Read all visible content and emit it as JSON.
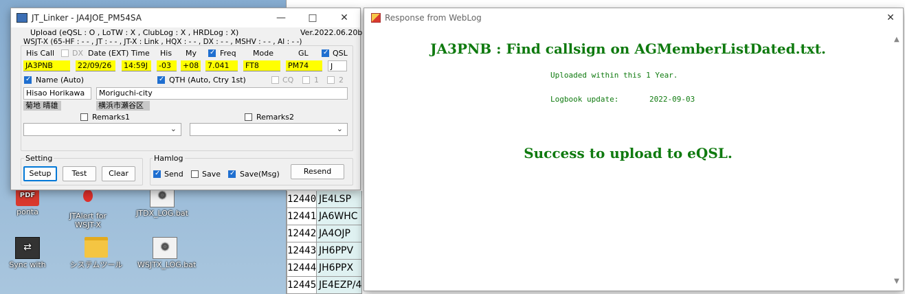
{
  "desktop": {
    "icons": [
      {
        "label": "ponta",
        "icon": "pdf-shortcut-icon"
      },
      {
        "label": "JTAlert for WSJT-X",
        "icon": "app-shortcut-icon"
      },
      {
        "label": "JTDX_LOG.bat",
        "icon": "batch-file-icon"
      },
      {
        "label": "Sync with",
        "icon": "sync-app-icon"
      },
      {
        "label": "システムツール",
        "icon": "folder-icon"
      },
      {
        "label": "WSJTX_LOG.bat",
        "icon": "batch-file-icon"
      }
    ]
  },
  "sheet": {
    "rows": [
      {
        "num": "12440",
        "call": "JE4LSP"
      },
      {
        "num": "12441",
        "call": "JA6WHC"
      },
      {
        "num": "12442",
        "call": "JA4OJP"
      },
      {
        "num": "12443",
        "call": "JH6PPV"
      },
      {
        "num": "12444",
        "call": "JH6PPX"
      },
      {
        "num": "12445",
        "call": "JE4EZP/4"
      }
    ]
  },
  "jt": {
    "title": "JT_Linker - JA4JOE_PM54SA",
    "upload_status": "Upload (eQSL : O , LoTW : X , ClubLog : X , HRDLog : X)",
    "version": "Ver.2022.06.20b",
    "wsjt_status": "WSJT-X (65-HF : - - , JT : - - , JT-X : Link , HQX : - - , DX : - - , MSHV : - - , AI : - -)",
    "headers": {
      "his_call": "His Call",
      "dx": "DX",
      "date_time": "Date (EXT) Time",
      "his": "His",
      "my": "My",
      "freq": "Freq",
      "mode": "Mode",
      "gl": "GL",
      "qsl": "QSL"
    },
    "values": {
      "his_call": "JA3PNB",
      "date": "22/09/26",
      "time": "14:59J",
      "his": "-03",
      "my": "+08",
      "freq": "7.041",
      "mode": "FT8",
      "gl": "PM74",
      "qsl": "J"
    },
    "name_label": "Name  (Auto)",
    "qth_label": "QTH  (Auto, Ctry 1st)",
    "cq_label": "CQ",
    "one_label": "1",
    "two_label": "2",
    "name_value": "Hisao Horikawa",
    "qth_value": "Moriguchi-city",
    "name_kanji": "菊地 晴雄",
    "qth_kanji": "横浜市瀬谷区",
    "remarks1_label": "Remarks1",
    "remarks2_label": "Remarks2",
    "setting_label": "Setting",
    "setup_label": "Setup",
    "test_label": "Test",
    "clear_label": "Clear",
    "hamlog_label": "Hamlog",
    "send_label": "Send",
    "save_label": "Save",
    "save_msg_label": "Save(Msg)",
    "resend_label": "Resend"
  },
  "weblog": {
    "title": "Response from WebLog",
    "heading": "JA3PNB : Find callsign on AGMemberListDated.txt.",
    "uploaded_line": "Uploaded within this 1 Year.",
    "logbook_label": "Logbook update:",
    "logbook_date": "2022-09-03",
    "success": "Success to upload to eQSL."
  },
  "colors": {
    "field_highlight": "#ffff00",
    "weblog_text": "#0f7a0f",
    "checkbox_accent": "#1f6fd0"
  }
}
